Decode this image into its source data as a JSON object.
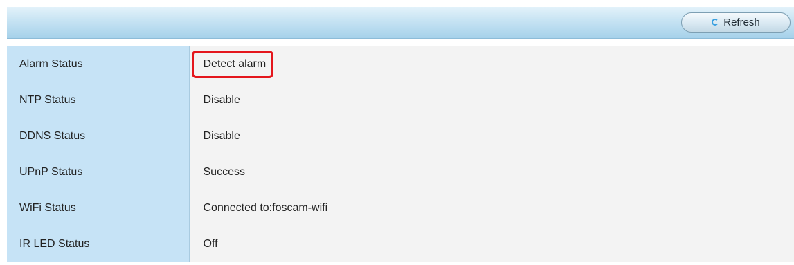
{
  "toolbar": {
    "refresh_label": "Refresh",
    "refresh_icon": "refresh-icon"
  },
  "status_rows": [
    {
      "label": "Alarm Status",
      "value": "Detect alarm",
      "highlighted": true
    },
    {
      "label": "NTP Status",
      "value": "Disable"
    },
    {
      "label": "DDNS Status",
      "value": "Disable"
    },
    {
      "label": "UPnP Status",
      "value": "Success"
    },
    {
      "label": "WiFi Status",
      "value": "Connected to:foscam-wifi"
    },
    {
      "label": "IR LED Status",
      "value": "Off"
    }
  ],
  "colors": {
    "highlight_border": "#e4161c",
    "label_background": "#c6e3f6",
    "value_background": "#f3f3f3"
  }
}
